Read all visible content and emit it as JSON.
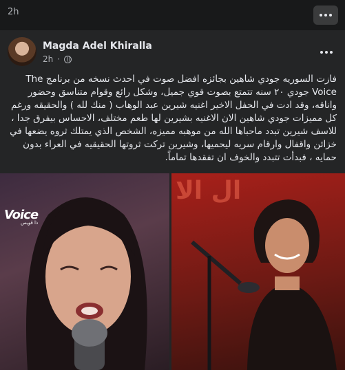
{
  "top": {
    "age": "2h"
  },
  "post": {
    "author": "Magda Adel Khiralla",
    "time": "2h",
    "privacy_icon": "globe-icon",
    "text": "فازت السوريه جودي شاهين بجائزه افضل صوت  في احدث نسخه من برنامج The Voice  جودي ٢٠ سنه تتمتع بصوت قوي  جميل، وشكل رائع  وقوام متناسق وحضور واناقه، وقد ادت في الحفل الاخير اغنيه شيرين عبد الوهاب ( منك لله ) والحقيقه ورغم كل مميزات جودي شاهين الان الاغنيه بشيرين لها طعم مختلف، الاحساس بيفرق جدا ، للاسف شيرين تبدد ماحباها الله من موهبه مميزه، الشخص الذي يمتلك ثروه يضعها في خزائن واقفال وارقام سريه ليحميها، وشيرين تركت ثروتها الحقيقيه في العراء  بدون حمايه ، فبدأت تتبدد والخوف ان تفقدها تماماً."
  },
  "photos": {
    "left_logo": "Voice",
    "left_logo_sub": "ذا ڤويس",
    "right_bg_text": "ال الا"
  },
  "colors": {
    "page_bg": "#18191a",
    "card_bg": "#242526",
    "text": "#e4e6eb",
    "muted": "#b0b3b8"
  }
}
